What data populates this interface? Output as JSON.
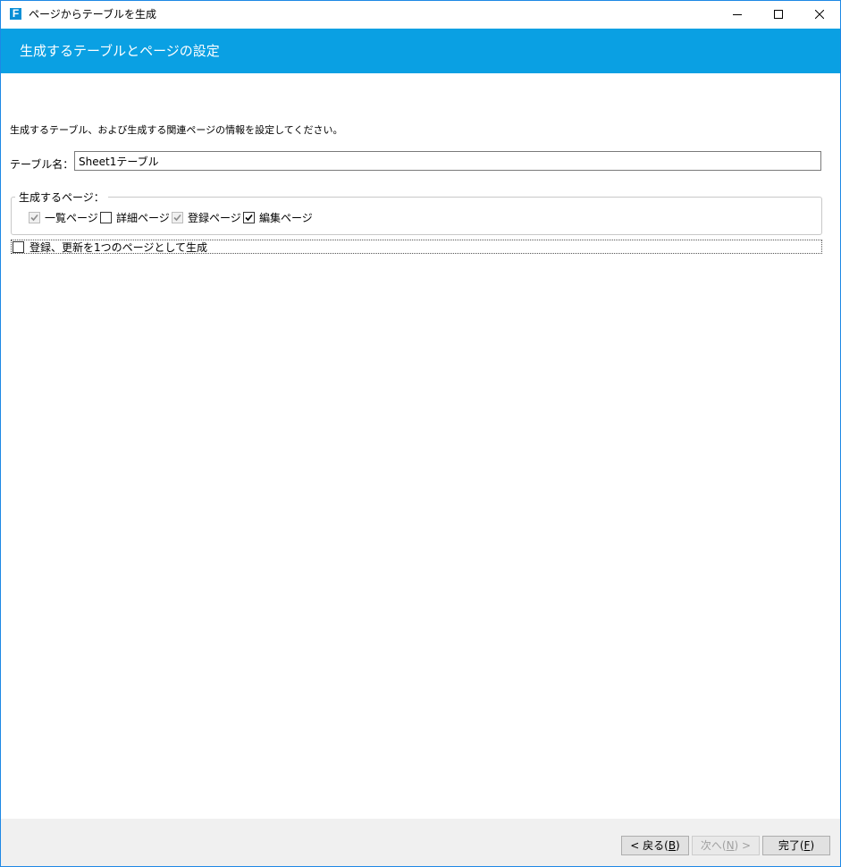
{
  "window": {
    "title": "ページからテーブルを生成",
    "app_icon_letter": "F"
  },
  "header": {
    "title": "生成するテーブルとページの設定"
  },
  "content": {
    "description": "生成するテーブル、および生成する関連ページの情報を設定してください。",
    "table_name_label": "テーブル名：",
    "table_name_value": "Sheet1テーブル",
    "pages_group_label": "生成するページ：",
    "pages": [
      {
        "label": "一覧ページ",
        "checked": true,
        "enabled": false
      },
      {
        "label": "詳細ページ",
        "checked": false,
        "enabled": true
      },
      {
        "label": "登録ページ",
        "checked": true,
        "enabled": false
      },
      {
        "label": "編集ページ",
        "checked": true,
        "enabled": true
      }
    ],
    "single_page_label": "登録、更新を1つのページとして生成",
    "single_page_checked": false
  },
  "footer": {
    "back_prefix": "< 戻る(",
    "back_key": "B",
    "back_suffix": ")",
    "next_prefix": "次へ(",
    "next_key": "N",
    "next_suffix": ") >",
    "finish_prefix": "完了(",
    "finish_key": "F",
    "finish_suffix": ")"
  },
  "colors": {
    "header_bg": "#0aa0e3",
    "window_border": "#1e88e5",
    "footer_bg": "#f0f0f0"
  }
}
